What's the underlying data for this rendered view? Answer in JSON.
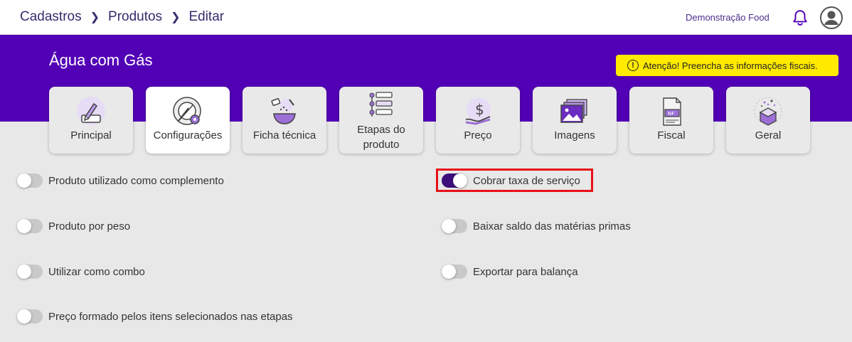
{
  "breadcrumb": {
    "items": [
      "Cadastros",
      "Produtos",
      "Editar"
    ]
  },
  "header": {
    "company": "Demonstração Food"
  },
  "product": {
    "name": "Água com Gás"
  },
  "alert": {
    "text": "Atenção! Preencha as informações fiscais."
  },
  "tabs": [
    {
      "label": "Principal",
      "icon": "edit-box-icon",
      "active": false
    },
    {
      "label": "Configurações",
      "icon": "plate-gear-icon",
      "active": true
    },
    {
      "label": "Ficha técnica",
      "icon": "mixing-bowl-icon",
      "active": false
    },
    {
      "label_line1": "Etapas do",
      "label_line2": "produto",
      "icon": "steps-list-icon",
      "active": false
    },
    {
      "label": "Preço",
      "icon": "dollar-hand-icon",
      "active": false
    },
    {
      "label": "Imagens",
      "icon": "images-icon",
      "active": false
    },
    {
      "label": "Fiscal",
      "icon": "nf-document-icon",
      "active": false
    },
    {
      "label": "Geral",
      "icon": "gift-box-icon",
      "active": false
    }
  ],
  "options": {
    "left": [
      {
        "label": "Produto utilizado como complemento",
        "checked": false
      },
      {
        "label": "Produto por peso",
        "checked": false
      },
      {
        "label": "Utilizar como combo",
        "checked": false
      },
      {
        "label": "Preço formado pelos itens selecionados nas etapas",
        "checked": false
      }
    ],
    "right": [
      {
        "label": "Cobrar taxa de serviço",
        "checked": true
      },
      {
        "label": "Baixar saldo das matérias primas",
        "checked": false
      },
      {
        "label": "Exportar para balança",
        "checked": false
      }
    ]
  },
  "colors": {
    "brand": "#5200b5",
    "toggle_on": "#3d0d7a",
    "alert": "#ffea00",
    "highlight": "#e8101a"
  }
}
